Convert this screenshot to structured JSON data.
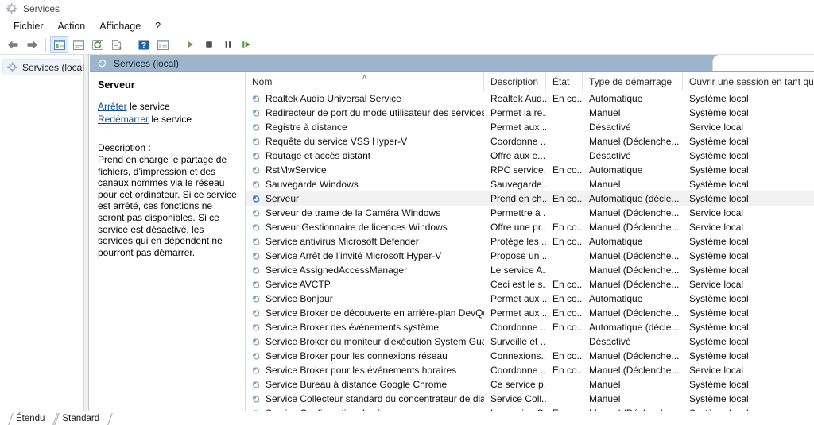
{
  "window": {
    "title": "Services",
    "icon": "services-gear-icon"
  },
  "menu": {
    "items": [
      {
        "label": "Fichier",
        "name": "menu-fichier"
      },
      {
        "label": "Action",
        "name": "menu-action"
      },
      {
        "label": "Affichage",
        "name": "menu-affichage"
      },
      {
        "label": "?",
        "name": "menu-help"
      }
    ]
  },
  "toolbar": {
    "buttons": [
      {
        "name": "back-arrow-icon",
        "glyph": "←"
      },
      {
        "name": "forward-arrow-icon",
        "glyph": "→"
      },
      {
        "name": "show-hide-tree-icon",
        "glyph": "▤"
      },
      {
        "name": "properties-icon",
        "glyph": "▣"
      },
      {
        "name": "refresh-icon",
        "glyph": "↻"
      },
      {
        "name": "export-list-icon",
        "glyph": "⎘"
      },
      {
        "name": "help-icon",
        "glyph": "?"
      },
      {
        "name": "show-console-tree-icon",
        "glyph": "▥"
      },
      {
        "name": "start-service-icon",
        "glyph": "▶"
      },
      {
        "name": "stop-service-icon",
        "glyph": "■"
      },
      {
        "name": "pause-service-icon",
        "glyph": "‖"
      },
      {
        "name": "restart-service-icon",
        "glyph": "▷"
      }
    ]
  },
  "tree": {
    "root_label": "Services (local)"
  },
  "pane": {
    "header_title": "Services (local)"
  },
  "detail": {
    "service_title": "Serveur",
    "stop_link": "Arrêter",
    "stop_suffix": " le service",
    "restart_link": "Redémarrer",
    "restart_suffix": " le service",
    "description_label": "Description :",
    "description_body": "Prend en charge le partage de fichiers, d’impression et des canaux nommés via le réseau pour cet ordinateur. Si ce service est arrêté, ces fonctions ne seront pas disponibles. Si ce service est désactivé, les services qui en dépendent ne pourront pas démarrer."
  },
  "list": {
    "columns": [
      {
        "label": "Nom",
        "name": "column-header-nom",
        "sorted": "asc"
      },
      {
        "label": "Description",
        "name": "column-header-description",
        "sorted": ""
      },
      {
        "label": "État",
        "name": "column-header-etat",
        "sorted": ""
      },
      {
        "label": "Type de démarrage",
        "name": "column-header-type-demarrage",
        "sorted": ""
      },
      {
        "label": "Ouvrir une session en tant que",
        "name": "column-header-ouvrir-session",
        "sorted": ""
      }
    ],
    "sort_glyph": "˄",
    "selected_index": 7,
    "rows": [
      {
        "name": "Realtek Audio Universal Service",
        "description": "Realtek Aud...",
        "etat": "En co...",
        "startup": "Automatique",
        "logon": "Système local"
      },
      {
        "name": "Redirecteur de port du mode utilisateur des services B...",
        "description": "Permet la re...",
        "etat": "",
        "startup": "Manuel",
        "logon": "Système local"
      },
      {
        "name": "Registre à distance",
        "description": "Permet aux ...",
        "etat": "",
        "startup": "Désactivé",
        "logon": "Service local"
      },
      {
        "name": "Requête du service VSS Hyper-V",
        "description": "Coordonne ...",
        "etat": "",
        "startup": "Manuel (Déclenche...",
        "logon": "Système local"
      },
      {
        "name": "Routage et accès distant",
        "description": "Offre aux e...",
        "etat": "",
        "startup": "Désactivé",
        "logon": "Système local"
      },
      {
        "name": "RstMwService",
        "description": "RPC service,...",
        "etat": "En co...",
        "startup": "Automatique",
        "logon": "Système local"
      },
      {
        "name": "Sauvegarde Windows",
        "description": "Sauvegarde ...",
        "etat": "",
        "startup": "Manuel",
        "logon": "Système local"
      },
      {
        "name": "Serveur",
        "description": "Prend en ch...",
        "etat": "En co...",
        "startup": "Automatique (décle...",
        "logon": "Système local"
      },
      {
        "name": "Serveur de trame de la Caméra Windows",
        "description": "Permettre à ...",
        "etat": "",
        "startup": "Manuel (Déclenche...",
        "logon": "Service local"
      },
      {
        "name": "Serveur Gestionnaire de licences Windows",
        "description": "Offre une pr...",
        "etat": "En co...",
        "startup": "Manuel (Déclenche...",
        "logon": "Service local"
      },
      {
        "name": "Service antivirus Microsoft Defender",
        "description": "Protège les ...",
        "etat": "En co...",
        "startup": "Automatique",
        "logon": "Système local"
      },
      {
        "name": "Service Arrêt de l’invité Microsoft Hyper-V",
        "description": "Propose un ...",
        "etat": "",
        "startup": "Manuel (Déclenche...",
        "logon": "Système local"
      },
      {
        "name": "Service AssignedAccessManager",
        "description": "Le service A...",
        "etat": "",
        "startup": "Manuel (Déclenche...",
        "logon": "Système local"
      },
      {
        "name": "Service AVCTP",
        "description": "Ceci est le s...",
        "etat": "En co...",
        "startup": "Manuel (Déclenche...",
        "logon": "Service local"
      },
      {
        "name": "Service Bonjour",
        "description": "Permet aux ...",
        "etat": "En co...",
        "startup": "Automatique",
        "logon": "Système local"
      },
      {
        "name": "Service Broker de découverte en arrière-plan DevQuery",
        "description": "Permet aux ...",
        "etat": "En co...",
        "startup": "Manuel (Déclenche...",
        "logon": "Système local"
      },
      {
        "name": "Service Broker des événements système",
        "description": "Coordonne ...",
        "etat": "En co...",
        "startup": "Automatique (décle...",
        "logon": "Système local"
      },
      {
        "name": "Service Broker du moniteur d'exécution System Guard",
        "description": "Surveille et ...",
        "etat": "",
        "startup": "Désactivé",
        "logon": "Système local"
      },
      {
        "name": "Service Broker pour les connexions réseau",
        "description": "Connexions...",
        "etat": "En co...",
        "startup": "Manuel (Déclenche...",
        "logon": "Système local"
      },
      {
        "name": "Service Broker pour les événements horaires",
        "description": "Coordonne ...",
        "etat": "En co...",
        "startup": "Manuel (Déclenche...",
        "logon": "Service local"
      },
      {
        "name": "Service Bureau à distance Google Chrome",
        "description": "Ce service p...",
        "etat": "",
        "startup": "Manuel",
        "logon": "Système local"
      },
      {
        "name": "Service Collecteur standard du concentrateur de diag...",
        "description": "Service Coll...",
        "etat": "",
        "startup": "Manuel",
        "logon": "Système local"
      },
      {
        "name": "Service Configuration du réseau",
        "description": "Le service C...",
        "etat": "En co...",
        "startup": "Manuel (Déclenche...",
        "logon": "Système local"
      }
    ]
  },
  "tabs": {
    "items": [
      {
        "label": "Étendu",
        "name": "tab-etendu",
        "active": false
      },
      {
        "label": "Standard",
        "name": "tab-standard",
        "active": true
      }
    ]
  },
  "colors": {
    "pane_header_bg": "#9db4ca",
    "link": "#0b4f9e",
    "selected_row_bg": "#f2f2f2",
    "toolbar_active_bg": "#ddeefb"
  }
}
